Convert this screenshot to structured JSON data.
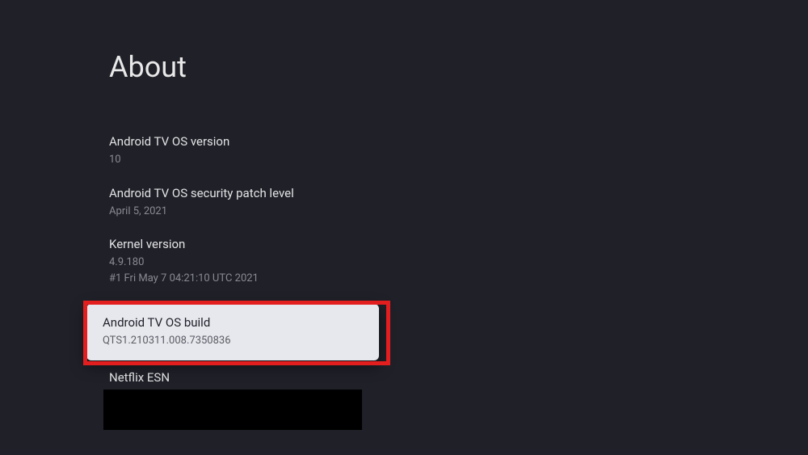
{
  "title": "About",
  "items": [
    {
      "label": "Android TV OS version",
      "value": "10"
    },
    {
      "label": "Android TV OS security patch level",
      "value": "April 5, 2021"
    },
    {
      "label": "Kernel version",
      "value": "4.9.180\n#1 Fri May 7 04:21:10 UTC 2021"
    }
  ],
  "selected": {
    "label": "Android TV OS build",
    "value": "QTS1.210311.008.7350836"
  },
  "netflix": {
    "label": "Netflix ESN"
  }
}
